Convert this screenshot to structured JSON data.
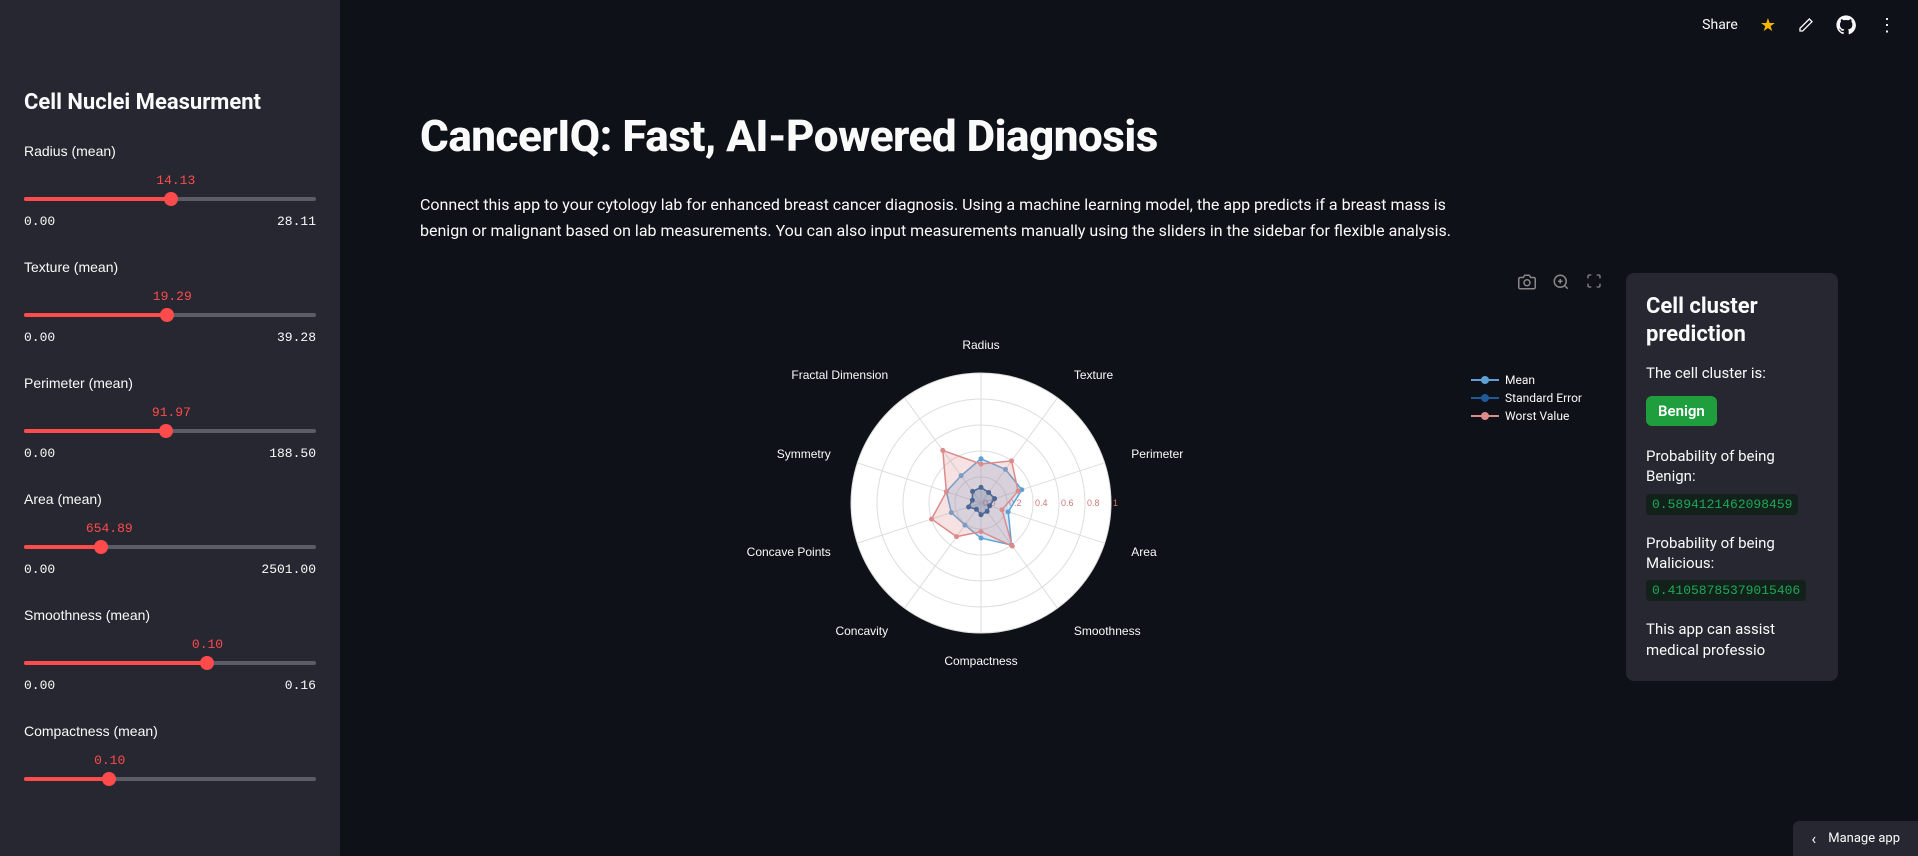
{
  "topbar": {
    "share": "Share"
  },
  "sidebar": {
    "title": "Cell Nuclei Measurment",
    "sliders": [
      {
        "label": "Radius (mean)",
        "value": "14.13",
        "min": "0.00",
        "max": "28.11",
        "pct": 50.3
      },
      {
        "label": "Texture (mean)",
        "value": "19.29",
        "min": "0.00",
        "max": "39.28",
        "pct": 49.1
      },
      {
        "label": "Perimeter (mean)",
        "value": "91.97",
        "min": "0.00",
        "max": "188.50",
        "pct": 48.8
      },
      {
        "label": "Area (mean)",
        "value": "654.89",
        "min": "0.00",
        "max": "2501.00",
        "pct": 26.2
      },
      {
        "label": "Smoothness (mean)",
        "value": "0.10",
        "min": "0.00",
        "max": "0.16",
        "pct": 62.5
      },
      {
        "label": "Compactness (mean)",
        "value": "0.10",
        "min": "",
        "max": "",
        "pct": 29.0
      }
    ]
  },
  "main": {
    "title": "CancerIQ: Fast, AI-Powered Diagnosis",
    "description": "Connect this app to your cytology lab for enhanced breast cancer diagnosis. Using a machine learning model, the app predicts if a breast mass is benign or malignant based on lab measurements. You can also input measurements manually using the sliders in the sidebar for flexible analysis."
  },
  "legend": {
    "mean": "Mean",
    "se": "Standard Error",
    "worst": "Worst Value"
  },
  "prediction": {
    "title": "Cell cluster prediction",
    "intro": "The cell cluster is:",
    "result": "Benign",
    "benign_label": "Probability of being Benign:",
    "benign_value": "0.5894121462098459",
    "malicious_label": "Probability of being Malicious:",
    "malicious_value": "0.41058785379015406",
    "disclaimer": "This app can assist medical professio"
  },
  "bottom": {
    "manage": "Manage app"
  },
  "chart_data": {
    "type": "radar",
    "axes": [
      "Radius",
      "Texture",
      "Perimeter",
      "Area",
      "Smoothness",
      "Compactness",
      "Concavity",
      "Concave Points",
      "Symmetry",
      "Fractal Dimension"
    ],
    "ticks": [
      0,
      0.2,
      0.4,
      0.6,
      0.8,
      1
    ],
    "series": [
      {
        "name": "Mean",
        "color": "#5ea0d6",
        "values": [
          0.34,
          0.32,
          0.33,
          0.22,
          0.4,
          0.27,
          0.21,
          0.24,
          0.28,
          0.26
        ]
      },
      {
        "name": "Standard Error",
        "color": "#1d5a96",
        "values": [
          0.12,
          0.1,
          0.11,
          0.07,
          0.08,
          0.09,
          0.06,
          0.1,
          0.07,
          0.11
        ]
      },
      {
        "name": "Worst Value",
        "color": "#dd8a8a",
        "values": [
          0.3,
          0.4,
          0.3,
          0.17,
          0.41,
          0.22,
          0.32,
          0.4,
          0.28,
          0.5
        ]
      }
    ]
  }
}
